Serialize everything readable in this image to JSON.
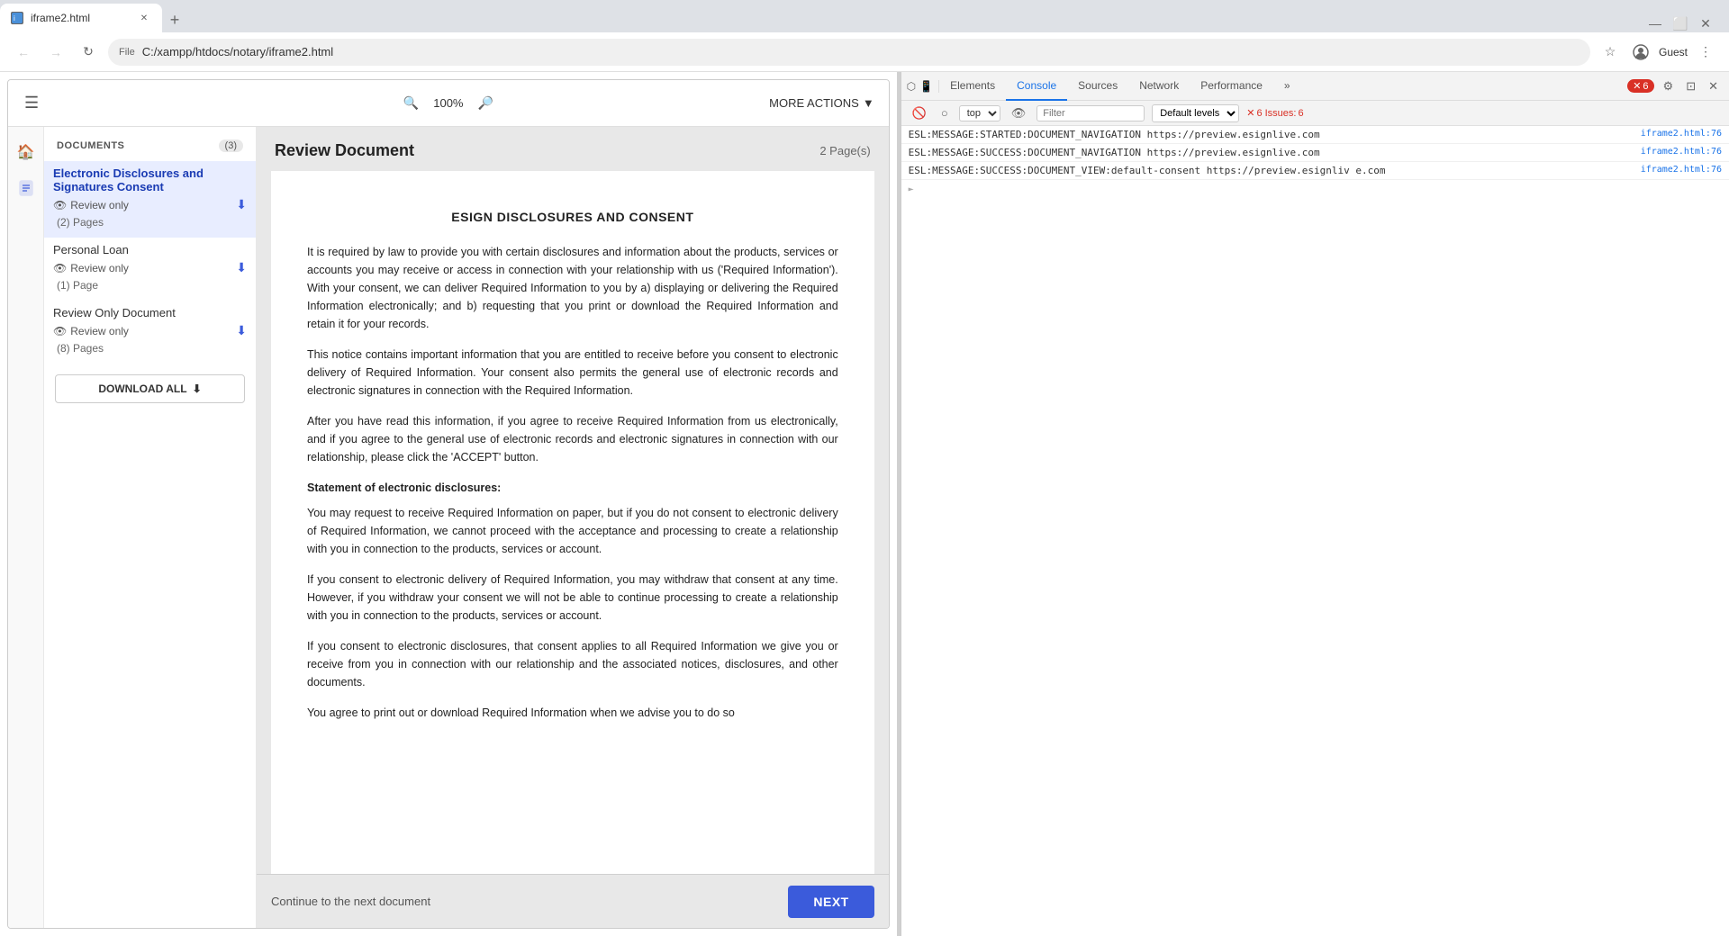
{
  "browser": {
    "tab_title": "iframe2.html",
    "address": "C:/xampp/htdocs/notary/iframe2.html",
    "address_prefix": "File",
    "user": "Guest"
  },
  "toolbar": {
    "zoom": "100%",
    "more_actions": "MORE ACTIONS"
  },
  "sidebar": {
    "documents_label": "DOCUMENTS",
    "documents_count": "(3)",
    "items": [
      {
        "title": "Electronic Disclosures and Signatures Consent",
        "review_label": "Review only",
        "pages": "(2) Pages",
        "active": true
      },
      {
        "title": "Personal Loan",
        "review_label": "Review only",
        "pages": "(1) Page",
        "active": false
      },
      {
        "title": "Review Only Document",
        "review_label": "Review only",
        "pages": "(8) Pages",
        "active": false
      }
    ],
    "download_all": "DOWNLOAD ALL"
  },
  "document": {
    "title": "Review Document",
    "pages": "2 Page(s)",
    "heading": "ESIGN DISCLOSURES AND CONSENT",
    "paragraphs": [
      "It is required by law to provide you with certain disclosures and information about the products, services or accounts you may receive or access in connection with your relationship with us ('Required Information'). With your consent, we can deliver Required Information to you by a) displaying or delivering the Required Information electronically; and b) requesting that you print or download the Required Information and retain it for your records.",
      "This notice contains important information that you are entitled to receive before you consent to electronic delivery of Required Information. Your consent also permits the general use of electronic records and electronic signatures in connection with the Required Information.",
      "After you have read this information, if you agree to receive Required Information from us electronically, and if you agree to the general use of electronic records and electronic signatures in connection with our relationship, please click the 'ACCEPT' button.",
      "Statement of electronic disclosures:",
      "You may request to receive Required Information on paper, but if you do not consent to electronic delivery of Required Information, we cannot proceed with the acceptance and processing to create a relationship with you in connection to the products, services or account.",
      "If you consent to electronic delivery of Required Information, you may withdraw that consent at any time. However, if you withdraw your consent we will not be able to continue processing to create a relationship with you in connection to the products, services or account.",
      "If you consent to electronic disclosures, that consent applies to all Required Information we give you or receive from you in connection with our relationship and the associated notices, disclosures, and other documents.",
      "You agree to print out or download Required Information when we advise you to do so"
    ],
    "footer_text": "Continue to the next document",
    "next_btn": "NEXT"
  },
  "devtools": {
    "tabs": [
      "Elements",
      "Console",
      "Sources",
      "Network",
      "Performance"
    ],
    "active_tab": "Console",
    "error_count": "6",
    "sub_toolbar": {
      "context": "top",
      "filter_placeholder": "Filter",
      "level": "Default levels",
      "issues_label": "6 Issues:",
      "issues_count": "6"
    },
    "messages": [
      {
        "text": "ESL:MESSAGE:STARTED:DOCUMENT_NAVIGATION https://preview.esignlive.com",
        "source": "iframe2.html:76"
      },
      {
        "text": "ESL:MESSAGE:SUCCESS:DOCUMENT_NAVIGATION https://preview.esignlive.com",
        "source": "iframe2.html:76"
      },
      {
        "text": "ESL:MESSAGE:SUCCESS:DOCUMENT_VIEW:default-consent https://preview.esignliv e.com",
        "source": "iframe2.html:76"
      }
    ]
  }
}
